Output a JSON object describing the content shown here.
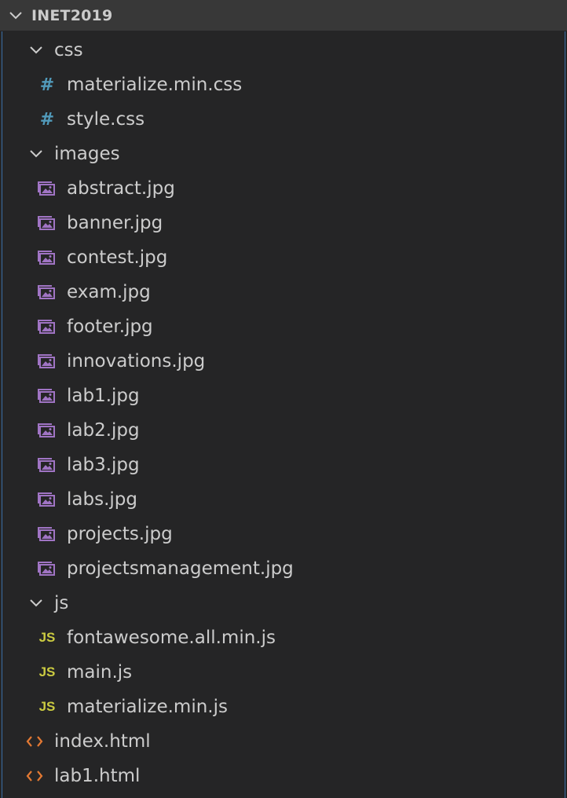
{
  "explorer": {
    "root_label": "INET2019"
  },
  "tree": {
    "folder_css": "css",
    "css_files": [
      "materialize.min.css",
      "style.css"
    ],
    "folder_images": "images",
    "image_files": [
      "abstract.jpg",
      "banner.jpg",
      "contest.jpg",
      "exam.jpg",
      "footer.jpg",
      "innovations.jpg",
      "lab1.jpg",
      "lab2.jpg",
      "lab3.jpg",
      "labs.jpg",
      "projects.jpg",
      "projectsmanagement.jpg"
    ],
    "folder_js": "js",
    "js_files": [
      "fontawesome.all.min.js",
      "main.js",
      "materialize.min.js"
    ],
    "html_files": [
      "index.html",
      "lab1.html"
    ]
  },
  "icons": {
    "css_file": "hash-icon",
    "image_file": "image-icon",
    "js_file": "js-icon",
    "html_file": "code-brackets-icon",
    "folder_expanded": "chevron-down-icon"
  },
  "colors": {
    "background": "#252526",
    "header_background": "#383838",
    "text": "#cccccc",
    "css_icon": "#519aba",
    "image_icon": "#a074c4",
    "js_icon": "#cbcb41",
    "html_icon": "#e37933",
    "focus_border": "#3b6ea5"
  }
}
